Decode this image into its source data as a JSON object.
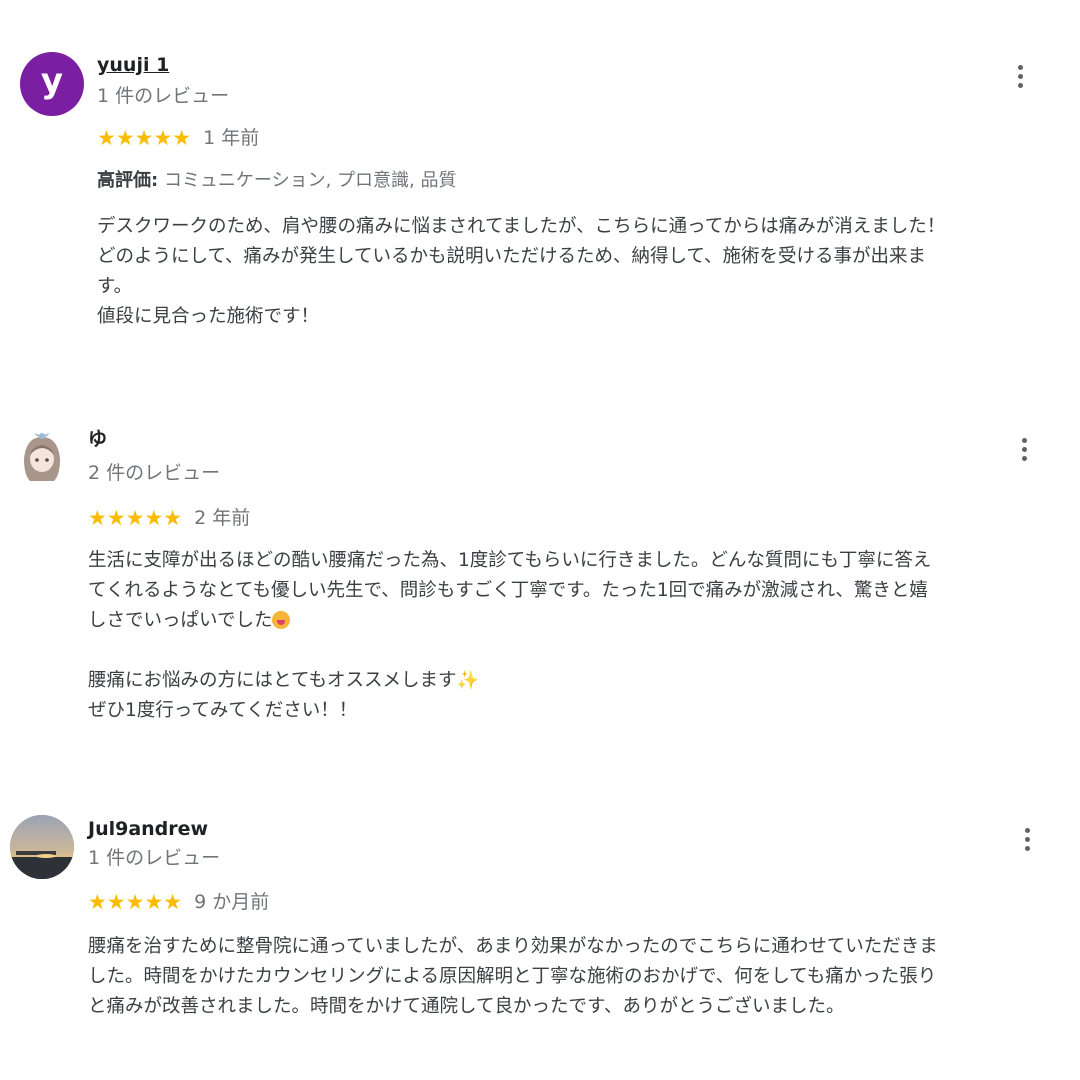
{
  "reviews": [
    {
      "avatar_letter": "y",
      "avatar_color": "#7b1fa2",
      "name": "yuuji 1",
      "count": "1 件のレビュー",
      "stars": "★★★★★",
      "rating": 5,
      "date": "1 年前",
      "tags_label": "高評価:",
      "tags": "コミュニケーション, プロ意識, 品質",
      "text": "デスクワークのため、肩や腰の痛みに悩まされてましたが、こちらに通ってからは痛みが消えました！\nどのようにして、痛みが発生しているかも説明いただけるため、納得して、施術を受ける事が出来ま\nす。\n値段に見合った施術です！"
    },
    {
      "name": "ゆ",
      "count": "2 件のレビュー",
      "stars": "★★★★★",
      "rating": 5,
      "date": "2 年前",
      "text_a": "生活に支障が出るほどの酷い腰痛だった為、1度診てもらいに行きました。どんな質問にも丁寧に答え\nてくれるようなとても優しい先生で、問診もすごく丁寧です。たった1回で痛みが激減され、驚きと嬉\nしさでいっぱいでした",
      "text_b": "腰痛にお悩みの方にはとてもオススメします",
      "text_c": "ぜひ1度行ってみてください！！",
      "emoji_1": "face-with-tongue-emoji",
      "emoji_2": "sparkles-emoji"
    },
    {
      "name": "Jul9andrew",
      "count": "1 件のレビュー",
      "stars": "★★★★★",
      "rating": 5,
      "date": "9 か月前",
      "text": "腰痛を治すために整骨院に通っていましたが、あまり効果がなかったのでこちらに通わせていただきま\nした。時間をかけたカウンセリングによる原因解明と丁寧な施術のおかげで、何をしても痛かった張り\nと痛みが改善されました。時間をかけて通院して良かったです、ありがとうございました。"
    }
  ],
  "colors": {
    "star": "#fbbc04",
    "secondary_text": "#70757a"
  }
}
